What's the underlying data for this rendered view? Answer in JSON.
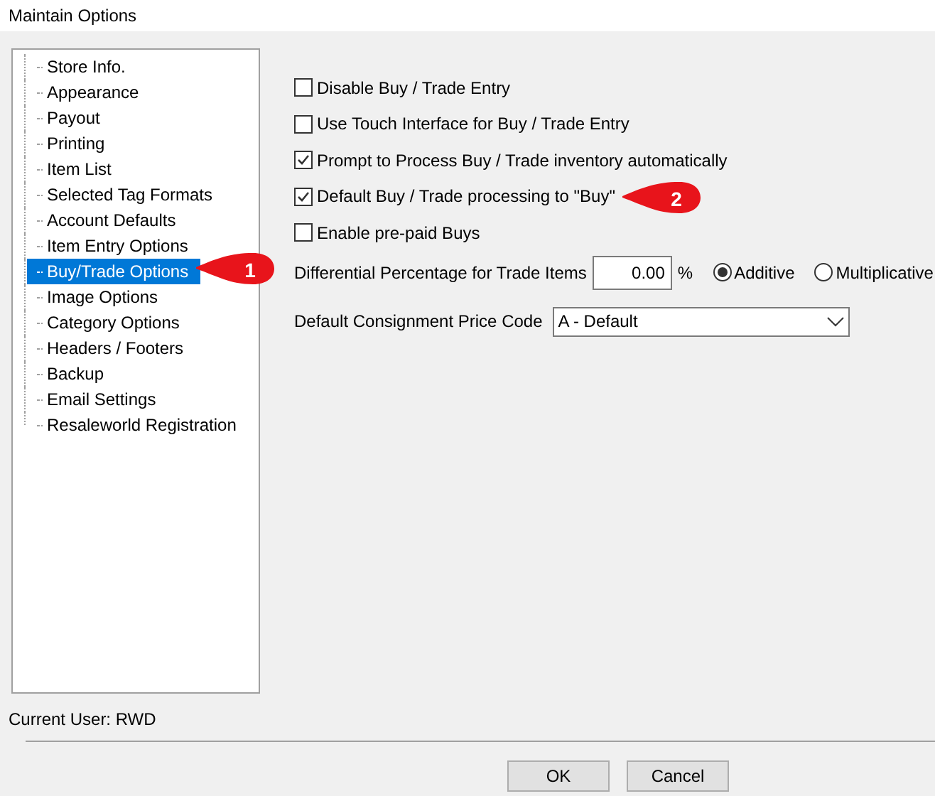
{
  "window": {
    "title": "Maintain Options"
  },
  "sidebar": {
    "items": [
      {
        "label": "Store Info.",
        "selected": false
      },
      {
        "label": "Appearance",
        "selected": false
      },
      {
        "label": "Payout",
        "selected": false
      },
      {
        "label": "Printing",
        "selected": false
      },
      {
        "label": "Item List",
        "selected": false
      },
      {
        "label": "Selected Tag Formats",
        "selected": false
      },
      {
        "label": "Account Defaults",
        "selected": false
      },
      {
        "label": "Item Entry Options",
        "selected": false
      },
      {
        "label": "Buy/Trade Options",
        "selected": true
      },
      {
        "label": "Image Options",
        "selected": false
      },
      {
        "label": "Category Options",
        "selected": false
      },
      {
        "label": "Headers / Footers",
        "selected": false
      },
      {
        "label": "Backup",
        "selected": false
      },
      {
        "label": "Email Settings",
        "selected": false
      },
      {
        "label": "Resaleworld Registration",
        "selected": false
      }
    ]
  },
  "options": [
    {
      "label": "Disable Buy / Trade Entry",
      "checked": false
    },
    {
      "label": "Use Touch Interface for Buy / Trade Entry",
      "checked": false
    },
    {
      "label": "Prompt to Process Buy / Trade inventory automatically",
      "checked": true
    },
    {
      "label": "Default Buy / Trade processing to \"Buy\"",
      "checked": true
    },
    {
      "label": "Enable pre-paid Buys",
      "checked": false
    }
  ],
  "differential": {
    "label": "Differential Percentage for Trade Items",
    "value": "0.00",
    "unit": "%",
    "modes": [
      {
        "label": "Additive",
        "selected": true
      },
      {
        "label": "Multiplicative",
        "selected": false
      }
    ]
  },
  "consignment": {
    "label": "Default Consignment Price Code",
    "value": "A - Default"
  },
  "callouts": [
    "1",
    "2"
  ],
  "status": "Current User: RWD",
  "buttons": [
    "OK",
    "Cancel"
  ]
}
